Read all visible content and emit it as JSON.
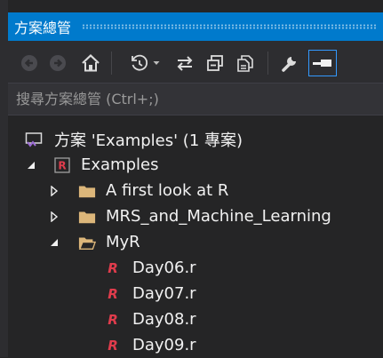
{
  "window": {
    "title": "方案總管"
  },
  "toolbar": {
    "buttons": [
      {
        "icon": "back-arrow-icon",
        "enabled": false
      },
      {
        "icon": "forward-arrow-icon",
        "enabled": false
      },
      {
        "icon": "home-icon",
        "enabled": true
      },
      {
        "icon": "pending-changes-filter-icon",
        "enabled": true
      },
      {
        "icon": "sync-with-active-document-icon",
        "enabled": true
      },
      {
        "icon": "collapse-all-icon",
        "enabled": true
      },
      {
        "icon": "show-all-files-icon",
        "enabled": true
      },
      {
        "icon": "properties-wrench-icon",
        "enabled": true
      },
      {
        "icon": "preview-selected-items-icon",
        "enabled": true,
        "active": true
      }
    ]
  },
  "search": {
    "placeholder": "搜尋方案總管 (Ctrl+;)"
  },
  "tree": {
    "solution_label": "方案 'Examples' (1 專案)",
    "project_label": "Examples",
    "folders": [
      {
        "label": "A first look at R",
        "expanded": false
      },
      {
        "label": "MRS_and_Machine_Learning",
        "expanded": false
      },
      {
        "label": "MyR",
        "expanded": true
      }
    ],
    "files": [
      {
        "label": "Day06.r"
      },
      {
        "label": "Day07.r"
      },
      {
        "label": "Day08.r"
      },
      {
        "label": "Day09.r"
      }
    ]
  },
  "colors": {
    "accent": "#007acc",
    "background": "#252526",
    "folder": "#dcb67a",
    "r_file": "#e03c4c"
  }
}
